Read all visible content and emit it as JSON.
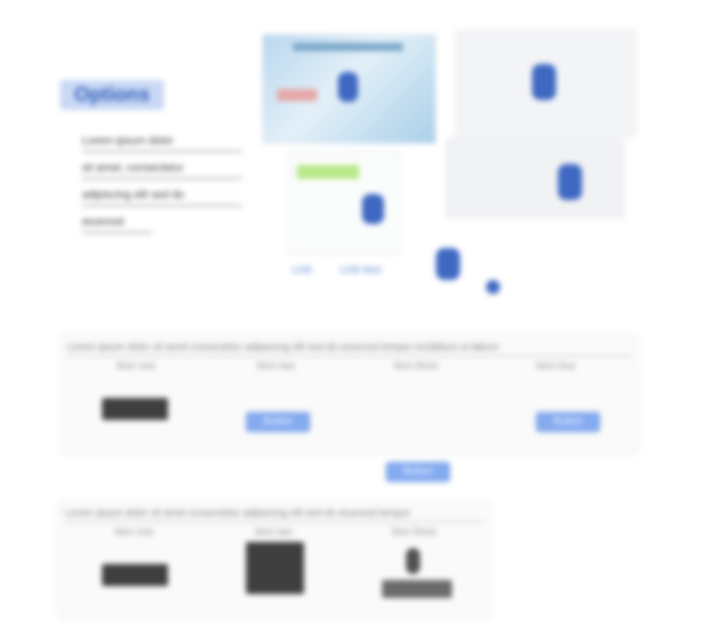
{
  "title": "Options",
  "bullets": [
    "Lorem ipsum dolor",
    "sit amet, consectetur",
    "adipiscing elit sed do",
    "eiusmod"
  ],
  "links": [
    "Link",
    "Link text"
  ],
  "section1": {
    "heading": "Lorem ipsum dolor sit amet consectetur adipiscing elit sed do eiusmod tempor incididunt ut labore",
    "columns": [
      "Item one",
      "Item two",
      "Item three",
      "Item four"
    ],
    "buttons": [
      "Button",
      "Button",
      "Button"
    ]
  },
  "section2": {
    "heading": "Lorem ipsum dolor sit amet consectetur adipiscing elit sed do eiusmod tempor",
    "columns": [
      "Item one",
      "Item two",
      "Item three"
    ]
  },
  "colors": {
    "accent": "#3e68c2",
    "button": "#84aaf0",
    "highlight": "#b8e88a"
  },
  "icons": [
    "map-marker-icon"
  ]
}
